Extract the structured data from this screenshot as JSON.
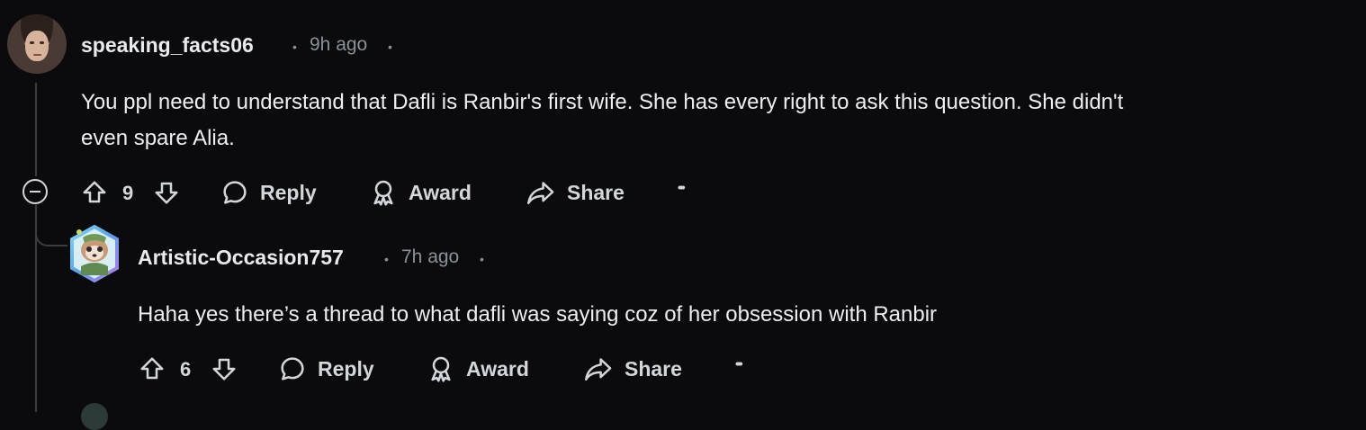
{
  "comments": [
    {
      "author": "speaking_facts06",
      "dot_before": "•",
      "time": "9h ago",
      "dot_after": "•",
      "body_line1": "You ppl need to understand that Dafli is Ranbir's first wife. She has every right to ask this question. She didn't",
      "body_line2": "even spare Alia.",
      "votes": "9",
      "reply_label": "Reply",
      "award_label": "Award",
      "share_label": "Share",
      "more_label": "•••"
    },
    {
      "author": "Artistic-Occasion757",
      "dot_before": "•",
      "time": "7h ago",
      "dot_after": "•",
      "body_line1": "Haha yes there’s a thread to what dafli was saying coz of her obsession with Ranbir",
      "votes": "6",
      "reply_label": "Reply",
      "award_label": "Award",
      "share_label": "Share",
      "more_label": "•••"
    }
  ],
  "colors": {
    "background": "#0b0b0d",
    "text": "#eceef0",
    "meta": "#8b9196",
    "thread_line": "#3a3d40"
  },
  "icons": [
    "upvote-icon",
    "downvote-icon",
    "comment-bubble-icon",
    "award-ribbon-icon",
    "share-arrow-icon",
    "more-dots-icon",
    "collapse-minus-icon"
  ]
}
